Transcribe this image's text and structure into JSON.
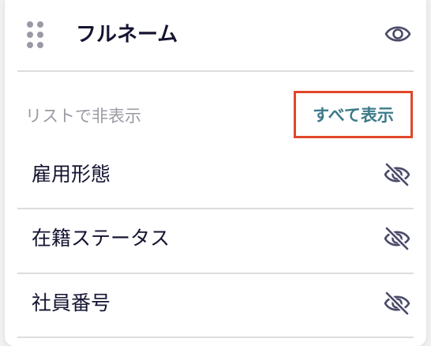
{
  "header": {
    "field_name": "フルネーム",
    "icons": {
      "drag": "drag-handle-icon",
      "visibility": "eye-icon"
    }
  },
  "hidden_section": {
    "label": "リストで非表示",
    "show_all_label": "すべて表示",
    "show_all_highlight_color": "#e0482a",
    "items": [
      {
        "label": "雇用形態",
        "icon": "eye-off-icon"
      },
      {
        "label": "在籍ステータス",
        "icon": "eye-off-icon"
      },
      {
        "label": "社員番号",
        "icon": "eye-off-icon"
      }
    ]
  },
  "colors": {
    "text": "#141432",
    "muted": "#9a9aa3",
    "accent": "#3d7a8a",
    "icon": "#4a4a6a"
  }
}
